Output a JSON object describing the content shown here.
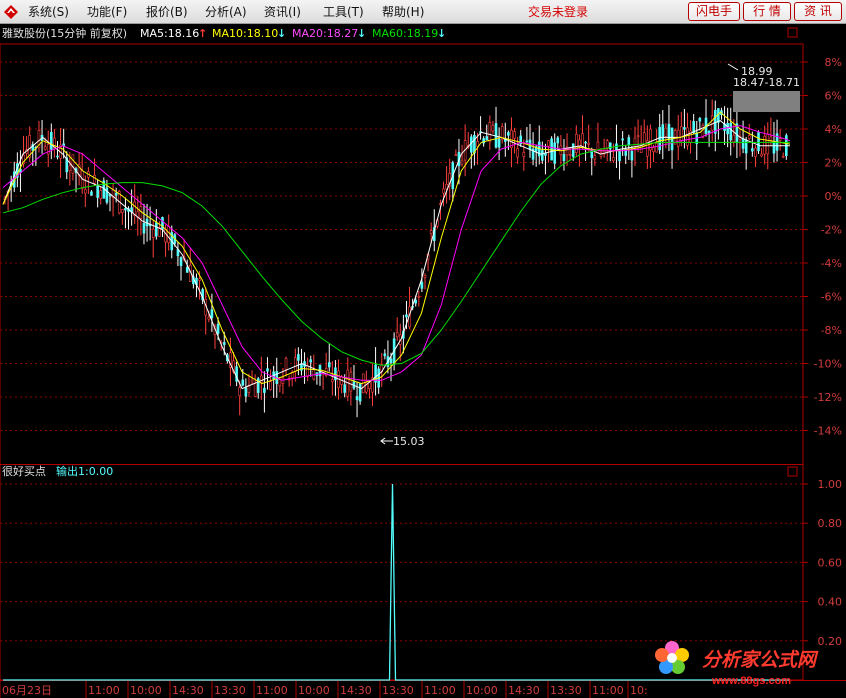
{
  "menu": {
    "items": [
      "系统(S)",
      "功能(F)",
      "报价(B)",
      "分析(A)",
      "资讯(I)",
      "工具(T)",
      "帮助(H)"
    ],
    "status": "交易未登录",
    "buttons": [
      "闪电手",
      "行 情",
      "资 讯"
    ]
  },
  "header": {
    "stock": "雅致股份(15分钟 前复权)",
    "ma5": "MA5:18.16",
    "ma10": "MA10:18.10",
    "ma20": "MA20:18.27",
    "ma60": "MA60:18.19",
    "ma5_arrow": "↑",
    "ma10_arrow": "↓",
    "ma20_arrow": "↓",
    "ma60_arrow": "↓",
    "colors": {
      "ma5": "#ffffff",
      "ma10": "#ffff00",
      "ma20": "#ff00ff",
      "ma60": "#00e000",
      "up": "#ff3c3c",
      "down": "#54fcfc"
    }
  },
  "main_chart": {
    "high_label": "18.99",
    "range_label": "18.47-18.71",
    "low_label": "15.03",
    "y_ticks": [
      "8%",
      "6%",
      "4%",
      "2%",
      "0%",
      "-2%",
      "-4%",
      "-6%",
      "-8%",
      "-10%",
      "-12%",
      "-14%"
    ]
  },
  "indicator": {
    "name": "很好买点",
    "output": "输出1:0.00",
    "y_ticks": [
      "1.00",
      "0.80",
      "0.60",
      "0.40",
      "0.20"
    ]
  },
  "time_axis": {
    "labels": [
      "06月23日",
      "11:00",
      "10:00",
      "14:30",
      "13:30",
      "11:00",
      "10:00",
      "14:30",
      "13:30",
      "11:00",
      "10:00",
      "14:30",
      "13:30",
      "11:00",
      "10:"
    ]
  },
  "watermark": {
    "title": "分析家公式网",
    "url": "www.88gs.com"
  },
  "footer_site": "www.88gs.com",
  "chart_data": [
    {
      "type": "line",
      "title": "",
      "xlabel": "",
      "ylabel": "",
      "ylim": [
        -15,
        9
      ],
      "note_scale": "percent",
      "series": [
        {
          "name": "MA5",
          "x": [
            0,
            20,
            40,
            60,
            80,
            100,
            120,
            140,
            160,
            180,
            200,
            220,
            240,
            260,
            280,
            300,
            320,
            340,
            360,
            380,
            400,
            420,
            440,
            460,
            480,
            500,
            520,
            540,
            560,
            580,
            600,
            620,
            640,
            660,
            680,
            700,
            720,
            740,
            760,
            780,
            790
          ],
          "values": [
            -0.5,
            2.5,
            3.5,
            2.5,
            1.0,
            0.5,
            -0.5,
            -1.5,
            -2.0,
            -3.5,
            -6.0,
            -9.0,
            -11.5,
            -11.0,
            -10.5,
            -10.0,
            -10.5,
            -11.0,
            -11.5,
            -10.5,
            -8.5,
            -5,
            -0.5,
            2.5,
            3.8,
            3.5,
            3.0,
            2.5,
            2.8,
            3.0,
            2.5,
            2.8,
            3.0,
            3.5,
            3.5,
            4.0,
            4.5,
            3.5,
            3.0,
            3.0,
            3.0
          ]
        },
        {
          "name": "MA10",
          "x": [
            0,
            20,
            40,
            60,
            80,
            100,
            120,
            140,
            160,
            180,
            200,
            220,
            240,
            260,
            280,
            300,
            320,
            340,
            360,
            380,
            400,
            420,
            440,
            460,
            480,
            500,
            520,
            540,
            560,
            580,
            600,
            620,
            640,
            660,
            680,
            700,
            720,
            740,
            760,
            780,
            790
          ],
          "values": [
            -0.5,
            2.0,
            3.3,
            2.8,
            1.5,
            0.8,
            0,
            -1.0,
            -1.8,
            -3.0,
            -5.0,
            -8.0,
            -10.5,
            -11.2,
            -10.8,
            -10.3,
            -10.4,
            -10.8,
            -11.2,
            -10.8,
            -9.5,
            -7,
            -2.5,
            1.5,
            3.2,
            3.5,
            3.2,
            2.8,
            2.7,
            2.9,
            2.7,
            2.7,
            2.9,
            3.3,
            3.5,
            3.8,
            5.0,
            4.0,
            3.4,
            3.2,
            3.1
          ]
        },
        {
          "name": "MA20",
          "x": [
            0,
            20,
            40,
            60,
            80,
            100,
            120,
            140,
            160,
            180,
            200,
            220,
            240,
            260,
            280,
            300,
            320,
            340,
            360,
            380,
            400,
            420,
            440,
            460,
            480,
            500,
            520,
            540,
            560,
            580,
            600,
            620,
            640,
            660,
            680,
            700,
            720,
            740,
            760,
            780,
            790
          ],
          "values": [
            0.5,
            1.5,
            2.5,
            3.0,
            2.5,
            1.5,
            0.5,
            -0.5,
            -1.5,
            -2.5,
            -4.0,
            -6.5,
            -9.0,
            -10.5,
            -11.0,
            -10.8,
            -10.6,
            -10.8,
            -11.0,
            -11.0,
            -10.5,
            -9.5,
            -6.5,
            -2.0,
            1.5,
            2.8,
            3.2,
            3.0,
            2.8,
            2.8,
            2.7,
            2.7,
            2.8,
            3.0,
            3.3,
            3.5,
            4.0,
            4.2,
            3.8,
            3.5,
            3.3
          ]
        },
        {
          "name": "MA60",
          "x": [
            0,
            20,
            40,
            60,
            80,
            100,
            120,
            140,
            160,
            180,
            200,
            220,
            240,
            260,
            280,
            300,
            320,
            340,
            360,
            380,
            400,
            420,
            440,
            460,
            480,
            500,
            520,
            540,
            560,
            580,
            600,
            620,
            640,
            660,
            680,
            700,
            720,
            740,
            760,
            780,
            790
          ],
          "values": [
            -1.0,
            -0.7,
            -0.2,
            0.2,
            0.5,
            0.7,
            0.8,
            0.8,
            0.6,
            0.2,
            -0.6,
            -1.8,
            -3.3,
            -4.8,
            -6.2,
            -7.5,
            -8.5,
            -9.3,
            -9.8,
            -10.1,
            -10.0,
            -9.4,
            -8.0,
            -6.3,
            -4.5,
            -2.7,
            -0.9,
            0.7,
            1.8,
            2.5,
            2.8,
            3.0,
            3.1,
            3.2,
            3.2,
            3.2,
            3.2,
            3.2,
            3.2,
            3.2,
            3.2
          ]
        }
      ]
    },
    {
      "type": "line",
      "title": "",
      "xlabel": "",
      "ylabel": "",
      "ylim": [
        0,
        1.08
      ],
      "series": [
        {
          "name": "输出1",
          "x": [
            0,
            388,
            391,
            394,
            790
          ],
          "values": [
            0,
            0,
            1.0,
            0,
            0
          ]
        }
      ]
    }
  ]
}
